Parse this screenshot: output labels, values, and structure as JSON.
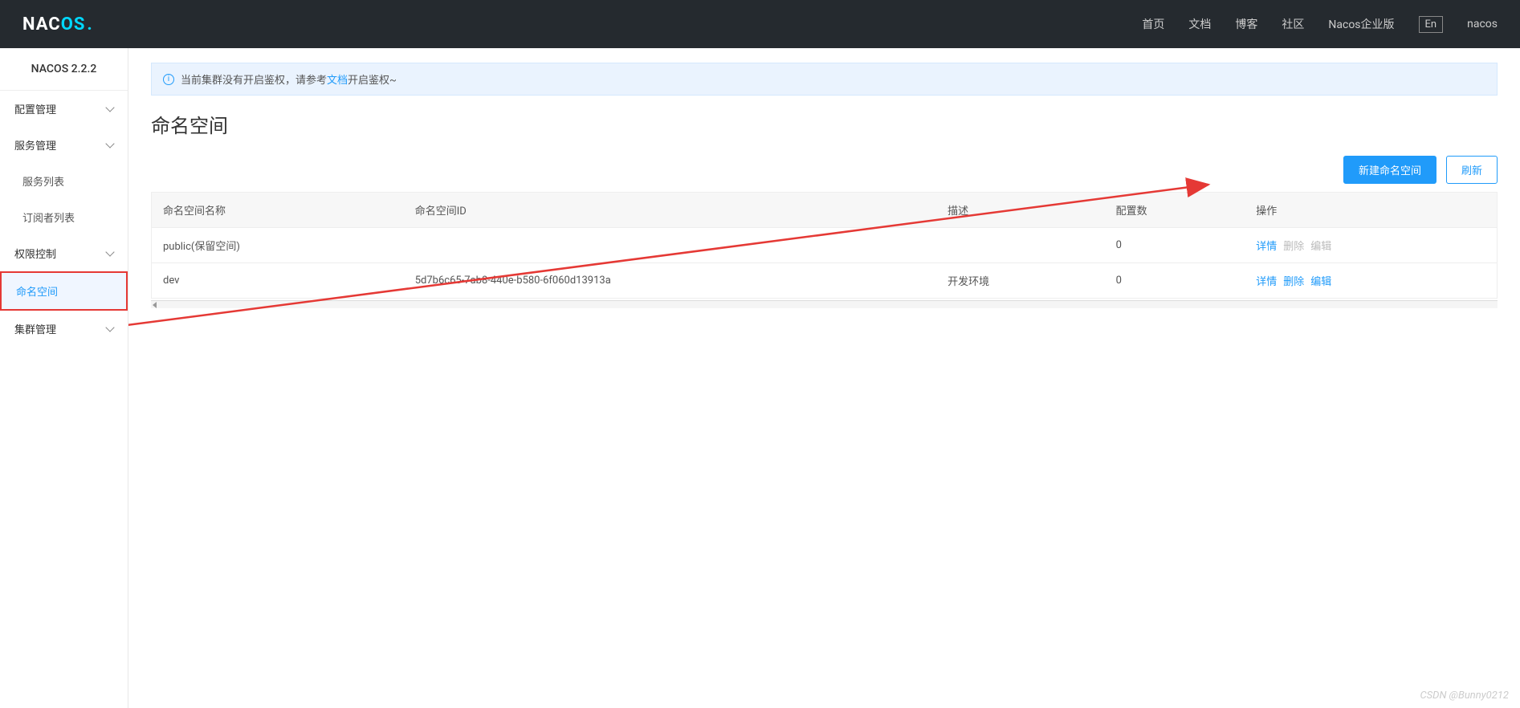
{
  "header": {
    "logo_part1": "NAC",
    "logo_part2": "OS",
    "logo_dot": ".",
    "nav": [
      "首页",
      "文档",
      "博客",
      "社区",
      "Nacos企业版"
    ],
    "lang": "En",
    "user": "nacos"
  },
  "sidebar": {
    "title": "NACOS 2.2.2",
    "menu": {
      "config_mgmt": "配置管理",
      "service_mgmt": "服务管理",
      "service_list": "服务列表",
      "subscriber_list": "订阅者列表",
      "permission": "权限控制",
      "namespace": "命名空间",
      "cluster_mgmt": "集群管理"
    }
  },
  "alert": {
    "text1": "当前集群没有开启鉴权，请参考",
    "link": "文档",
    "text2": "开启鉴权~"
  },
  "page": {
    "title": "命名空间"
  },
  "toolbar": {
    "new_btn": "新建命名空间",
    "refresh_btn": "刷新"
  },
  "table": {
    "headers": {
      "name": "命名空间名称",
      "id": "命名空间ID",
      "desc": "描述",
      "config_count": "配置数",
      "action": "操作"
    },
    "actions": {
      "detail": "详情",
      "delete": "删除",
      "edit": "编辑"
    },
    "rows": [
      {
        "name": "public(保留空间)",
        "id": "",
        "desc": "",
        "config_count": "0",
        "delete_disabled": true,
        "edit_disabled": true
      },
      {
        "name": "dev",
        "id": "5d7b6c65-7ab8-440e-b580-6f060d13913a",
        "desc": "开发环境",
        "config_count": "0",
        "delete_disabled": false,
        "edit_disabled": false
      }
    ]
  },
  "watermark": "CSDN @Bunny0212"
}
